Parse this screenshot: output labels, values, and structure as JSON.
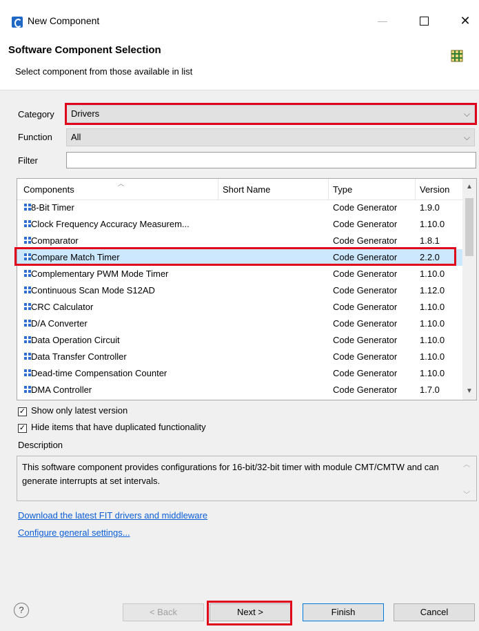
{
  "window": {
    "title": "New Component"
  },
  "header": {
    "title": "Software Component Selection",
    "subtitle": "Select component from those available in list"
  },
  "form": {
    "category_label": "Category",
    "category_value": "Drivers",
    "function_label": "Function",
    "function_value": "All",
    "filter_label": "Filter",
    "filter_value": ""
  },
  "table": {
    "columns": [
      "Components",
      "Short Name",
      "Type",
      "Version"
    ],
    "rows": [
      {
        "name": "8-Bit Timer",
        "short": "",
        "type": "Code Generator",
        "version": "1.9.0"
      },
      {
        "name": "Clock Frequency Accuracy Measurem...",
        "short": "",
        "type": "Code Generator",
        "version": "1.10.0"
      },
      {
        "name": "Comparator",
        "short": "",
        "type": "Code Generator",
        "version": "1.8.1"
      },
      {
        "name": "Compare Match Timer",
        "short": "",
        "type": "Code Generator",
        "version": "2.2.0"
      },
      {
        "name": "Complementary PWM Mode Timer",
        "short": "",
        "type": "Code Generator",
        "version": "1.10.0"
      },
      {
        "name": "Continuous Scan Mode S12AD",
        "short": "",
        "type": "Code Generator",
        "version": "1.12.0"
      },
      {
        "name": "CRC Calculator",
        "short": "",
        "type": "Code Generator",
        "version": "1.10.0"
      },
      {
        "name": "D/A Converter",
        "short": "",
        "type": "Code Generator",
        "version": "1.10.0"
      },
      {
        "name": "Data Operation Circuit",
        "short": "",
        "type": "Code Generator",
        "version": "1.10.0"
      },
      {
        "name": "Data Transfer Controller",
        "short": "",
        "type": "Code Generator",
        "version": "1.10.0"
      },
      {
        "name": "Dead-time Compensation Counter",
        "short": "",
        "type": "Code Generator",
        "version": "1.10.0"
      },
      {
        "name": "DMA Controller",
        "short": "",
        "type": "Code Generator",
        "version": "1.7.0"
      }
    ],
    "selected_index": 3
  },
  "options": {
    "show_latest_label": "Show only latest version",
    "show_latest_checked": true,
    "hide_duplicates_label": "Hide items that have duplicated functionality",
    "hide_duplicates_checked": true
  },
  "description": {
    "label": "Description",
    "text": "This software component provides configurations for 16-bit/32-bit timer with module CMT/CMTW and can generate interrupts at set intervals."
  },
  "links": {
    "download": "Download the latest FIT drivers and middleware",
    "configure": "Configure general settings..."
  },
  "buttons": {
    "help": "?",
    "back": "< Back",
    "next": "Next >",
    "finish": "Finish",
    "cancel": "Cancel"
  },
  "colors": {
    "highlight": "#e0001a",
    "selection": "#cce8ff",
    "link": "#0b5dd7",
    "icon_blue": "#2d6ed1"
  }
}
